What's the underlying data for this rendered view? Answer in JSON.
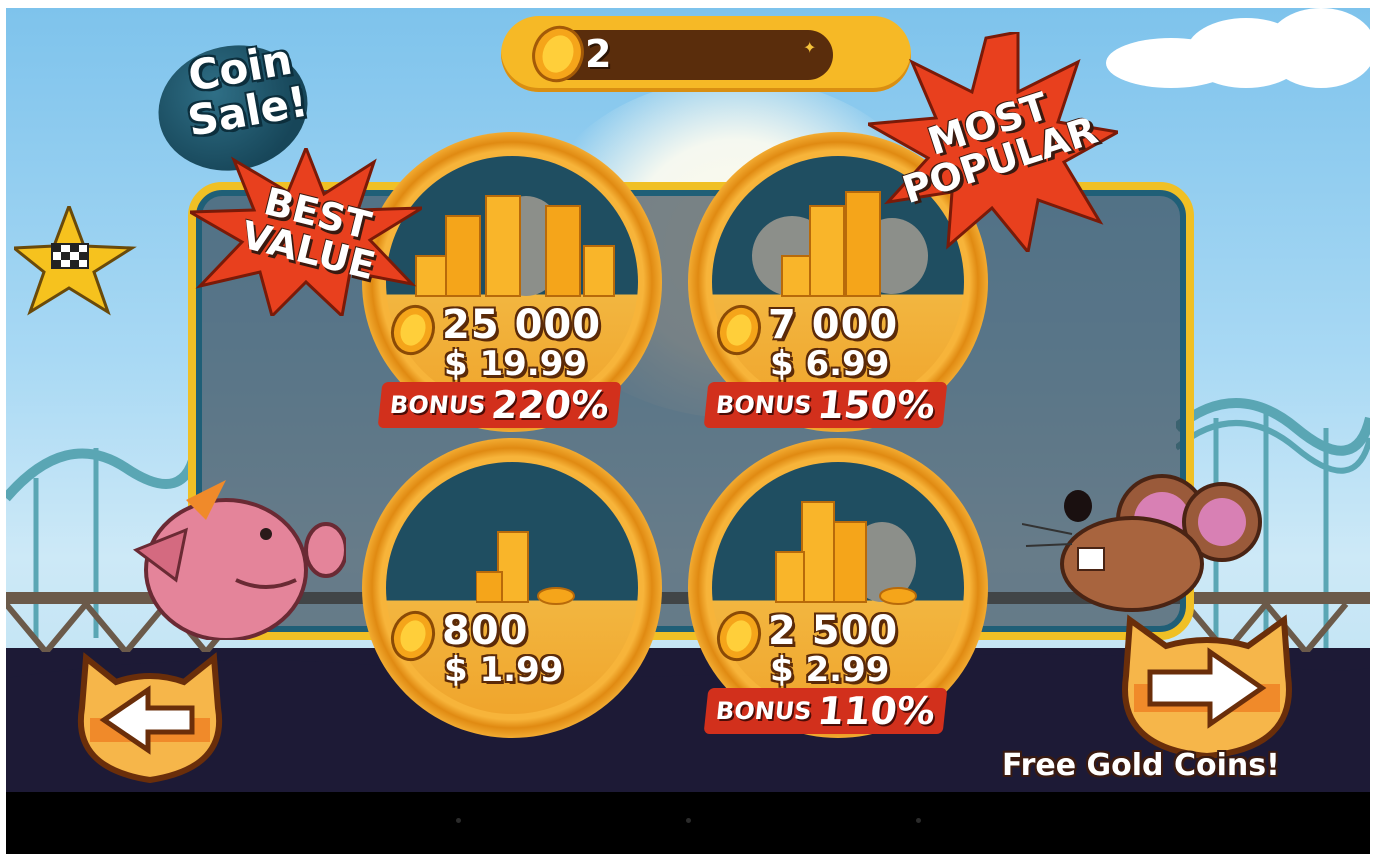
{
  "header": {
    "coin_balance": "2",
    "coin_icon": "gold-coin-icon"
  },
  "promo": {
    "coin_sale": "Coin\nSale!",
    "best_value": "BEST\nVALUE",
    "most_popular": "MOST\nPOPULAR"
  },
  "offers": [
    {
      "amount": "25 000",
      "price": "$ 19.99",
      "bonus_label": "BONUS",
      "bonus_value": "220%"
    },
    {
      "amount": "7 000",
      "price": "$ 6.99",
      "bonus_label": "BONUS",
      "bonus_value": "150%"
    },
    {
      "amount": "800",
      "price": "$ 1.99"
    },
    {
      "amount": "2 500",
      "price": "$ 2.99",
      "bonus_label": "BONUS",
      "bonus_value": "110%"
    }
  ],
  "footer": {
    "free_coins_label": "Free Gold Coins!",
    "back_icon": "arrow-left-icon",
    "next_icon": "arrow-right-icon"
  },
  "colors": {
    "coin_gold": "#f6b926",
    "bonus_red": "#d2301c",
    "burst_red": "#e8401e",
    "panel_border": "#f0c025"
  }
}
